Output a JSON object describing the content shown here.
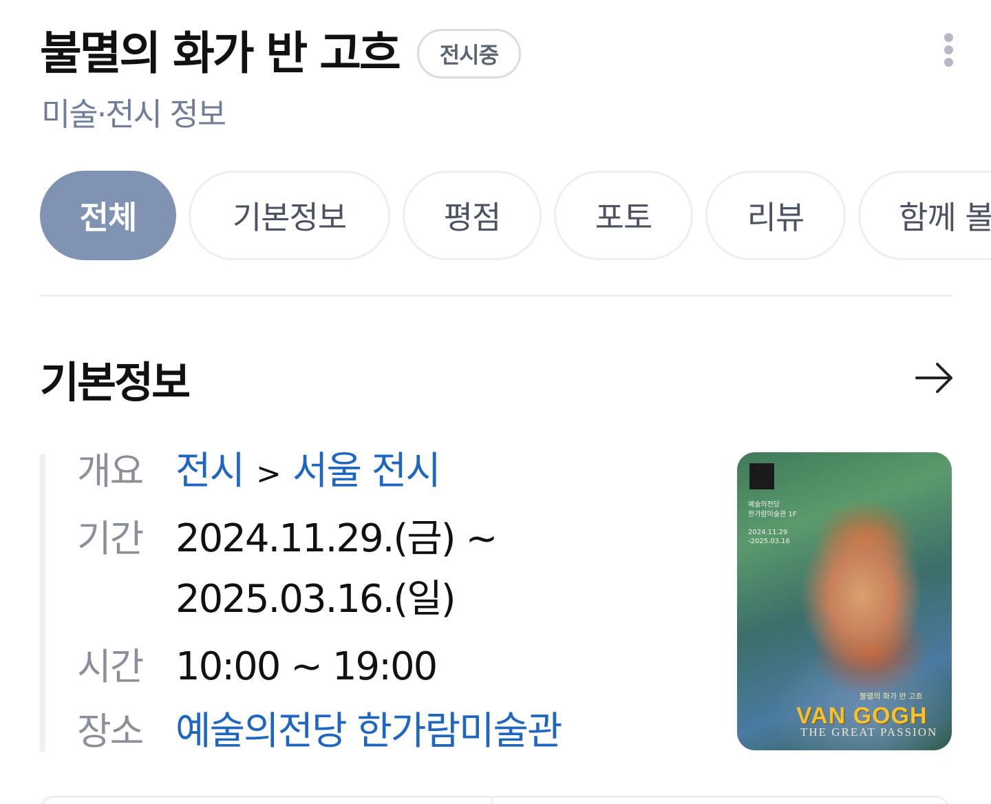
{
  "header": {
    "title": "불멸의 화가 반 고흐",
    "badge": "전시중",
    "subtitle": "미술·전시 정보",
    "more_icon": "more-vertical-icon"
  },
  "tabs": [
    {
      "label": "전체",
      "active": true
    },
    {
      "label": "기본정보",
      "active": false
    },
    {
      "label": "평점",
      "active": false
    },
    {
      "label": "포토",
      "active": false
    },
    {
      "label": "리뷰",
      "active": false
    },
    {
      "label": "함께 볼",
      "active": false
    }
  ],
  "section": {
    "title": "기본정보",
    "arrow_icon": "arrow-right-icon"
  },
  "info": {
    "overview_label": "개요",
    "overview_link1": "전시",
    "overview_sep": ">",
    "overview_link2": "서울 전시",
    "period_label": "기간",
    "period_start": "2024.11.29.(금) ~",
    "period_end": "2025.03.16.(일)",
    "time_label": "시간",
    "time_value": "10:00 ~ 19:00",
    "place_label": "장소",
    "place_value": "예술의전당 한가람미술관"
  },
  "poster": {
    "venue_line1": "예술의전당",
    "venue_line2": "한가람미술관 1F",
    "date_line1": "2024.11.29",
    "date_line2": "-2025.03.16",
    "kor_title": "불멸의 화가 반 고흐",
    "title": "VAN GOGH",
    "subtitle": "THE GREAT PASSION"
  },
  "colors": {
    "active_tab": "#8193b3",
    "link": "#1f66c0",
    "subtitle": "#707e98"
  }
}
